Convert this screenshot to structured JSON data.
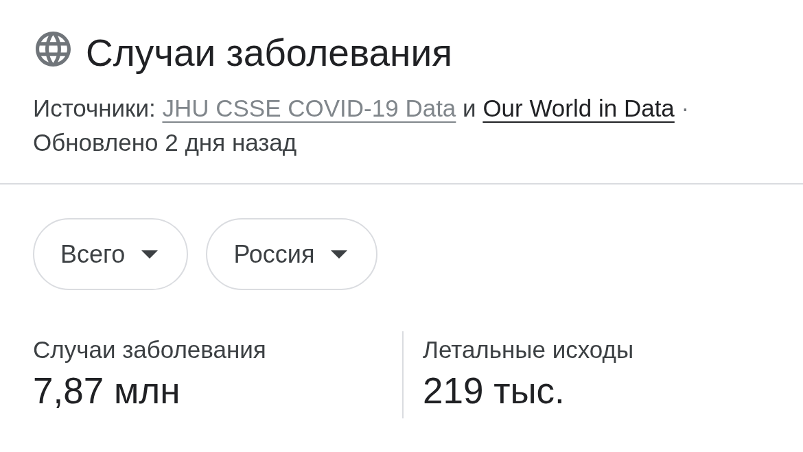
{
  "header": {
    "title": "Случаи заболевания",
    "sources_label": "Источники:",
    "sources": [
      {
        "text": "JHU CSSE COVID-19 Data",
        "visited": true
      },
      {
        "text": "Our World in Data",
        "visited": false
      }
    ],
    "conjunction": "и",
    "separator": "·",
    "updated": "Обновлено 2 дня назад"
  },
  "filters": [
    {
      "label": "Всего"
    },
    {
      "label": "Россия"
    }
  ],
  "stats": [
    {
      "label": "Случаи заболевания",
      "value": "7,87 млн"
    },
    {
      "label": "Летальные исходы",
      "value": "219 тыс."
    }
  ]
}
